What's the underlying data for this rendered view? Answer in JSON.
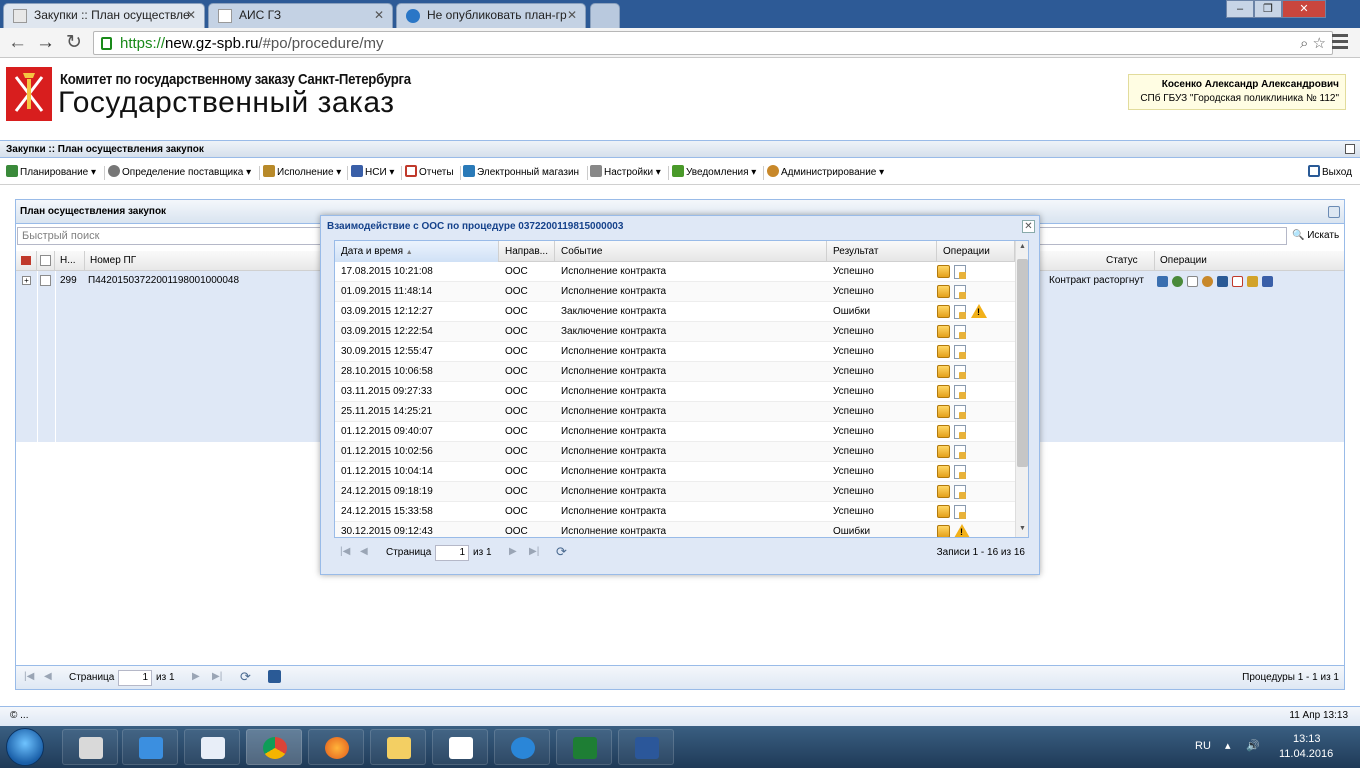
{
  "browser": {
    "tabs": [
      {
        "title": "Закупки :: План осуществле"
      },
      {
        "title": "АИС ГЗ"
      },
      {
        "title": "Не опубликовать план-гр"
      }
    ],
    "url_scheme": "https://",
    "url_host": "new.gz-spb.ru",
    "url_path": "/#po/procedure/my"
  },
  "header": {
    "org": "Комитет по государственному заказу Санкт-Петербурга",
    "title": "Государственный заказ",
    "user_name": "Косенко Александр Александрович",
    "user_org": "СПб ГБУЗ \"Городская поликлиника № 112\""
  },
  "breadcrumb": "Закупки :: План осуществления закупок",
  "toolbar": {
    "items": [
      {
        "label": "Планирование ▾",
        "color": "#3a8a3a"
      },
      {
        "label": "Определение поставщика ▾",
        "color": "#666666"
      },
      {
        "label": "Исполнение ▾",
        "color": "#b88a2a"
      },
      {
        "label": "НСИ ▾",
        "color": "#3a5fa8"
      },
      {
        "label": "Отчеты",
        "color": "#c0392b"
      },
      {
        "label": "Электронный магазин",
        "color": "#2a7ab8"
      },
      {
        "label": "Настройки ▾",
        "color": "#777777"
      },
      {
        "label": "Уведомления ▾",
        "color": "#4a9a2a"
      },
      {
        "label": "Администрирование ▾",
        "color": "#c8882a"
      }
    ],
    "exit_label": "Выход"
  },
  "panel": {
    "title": "План осуществления закупок",
    "search_placeholder": "Быстрый поиск",
    "search_button": "Искать",
    "columns": {
      "num": "Н...",
      "number": "Номер ПГ",
      "status": "Статус",
      "ops": "Операции"
    },
    "row": {
      "num": "299",
      "number": "П44201503722001198001000048",
      "status": "Контракт расторгнут"
    },
    "paging": {
      "page_label": "Страница",
      "page": "1",
      "of": "из 1",
      "summary": "Процедуры 1 - 1 из 1"
    }
  },
  "modal": {
    "title": "Взаимодействие с ООС по процедуре 0372200119815000003",
    "columns": {
      "date": "Дата и время",
      "dir": "Направ...",
      "event": "Событие",
      "result": "Результат",
      "ops": "Операции"
    },
    "rows": [
      {
        "date": "17.08.2015 10:21:08",
        "dir": "ООС",
        "event": "Исполнение контракта",
        "result": "Успешно",
        "icons": [
          "box",
          "doc"
        ]
      },
      {
        "date": "01.09.2015 11:48:14",
        "dir": "ООС",
        "event": "Исполнение контракта",
        "result": "Успешно",
        "icons": [
          "box",
          "doc"
        ]
      },
      {
        "date": "03.09.2015 12:12:27",
        "dir": "ООС",
        "event": "Заключение контракта",
        "result": "Ошибки",
        "icons": [
          "box",
          "doc",
          "warn"
        ]
      },
      {
        "date": "03.09.2015 12:22:54",
        "dir": "ООС",
        "event": "Заключение контракта",
        "result": "Успешно",
        "icons": [
          "box",
          "doc"
        ]
      },
      {
        "date": "30.09.2015 12:55:47",
        "dir": "ООС",
        "event": "Исполнение контракта",
        "result": "Успешно",
        "icons": [
          "box",
          "doc"
        ]
      },
      {
        "date": "28.10.2015 10:06:58",
        "dir": "ООС",
        "event": "Исполнение контракта",
        "result": "Успешно",
        "icons": [
          "box",
          "doc"
        ]
      },
      {
        "date": "03.11.2015 09:27:33",
        "dir": "ООС",
        "event": "Исполнение контракта",
        "result": "Успешно",
        "icons": [
          "box",
          "doc"
        ]
      },
      {
        "date": "25.11.2015 14:25:21",
        "dir": "ООС",
        "event": "Исполнение контракта",
        "result": "Успешно",
        "icons": [
          "box",
          "doc"
        ]
      },
      {
        "date": "01.12.2015 09:40:07",
        "dir": "ООС",
        "event": "Исполнение контракта",
        "result": "Успешно",
        "icons": [
          "box",
          "doc"
        ]
      },
      {
        "date": "01.12.2015 10:02:56",
        "dir": "ООС",
        "event": "Исполнение контракта",
        "result": "Успешно",
        "icons": [
          "box",
          "doc"
        ]
      },
      {
        "date": "01.12.2015 10:04:14",
        "dir": "ООС",
        "event": "Исполнение контракта",
        "result": "Успешно",
        "icons": [
          "box",
          "doc"
        ]
      },
      {
        "date": "24.12.2015 09:18:19",
        "dir": "ООС",
        "event": "Исполнение контракта",
        "result": "Успешно",
        "icons": [
          "box",
          "doc"
        ]
      },
      {
        "date": "24.12.2015 15:33:58",
        "dir": "ООС",
        "event": "Исполнение контракта",
        "result": "Успешно",
        "icons": [
          "box",
          "doc"
        ]
      },
      {
        "date": "30.12.2015 09:12:43",
        "dir": "ООС",
        "event": "Исполнение контракта",
        "result": "Ошибки",
        "icons": [
          "box",
          "warn"
        ]
      }
    ],
    "paging": {
      "page_label": "Страница",
      "page": "1",
      "of": "из 1",
      "summary": "Записи 1 - 16 из 16"
    }
  },
  "footer": {
    "copyright": "© ...",
    "datetime": "11 Апр 13:13"
  },
  "taskbar": {
    "lang": "RU",
    "time": "13:13",
    "date": "11.04.2016"
  }
}
